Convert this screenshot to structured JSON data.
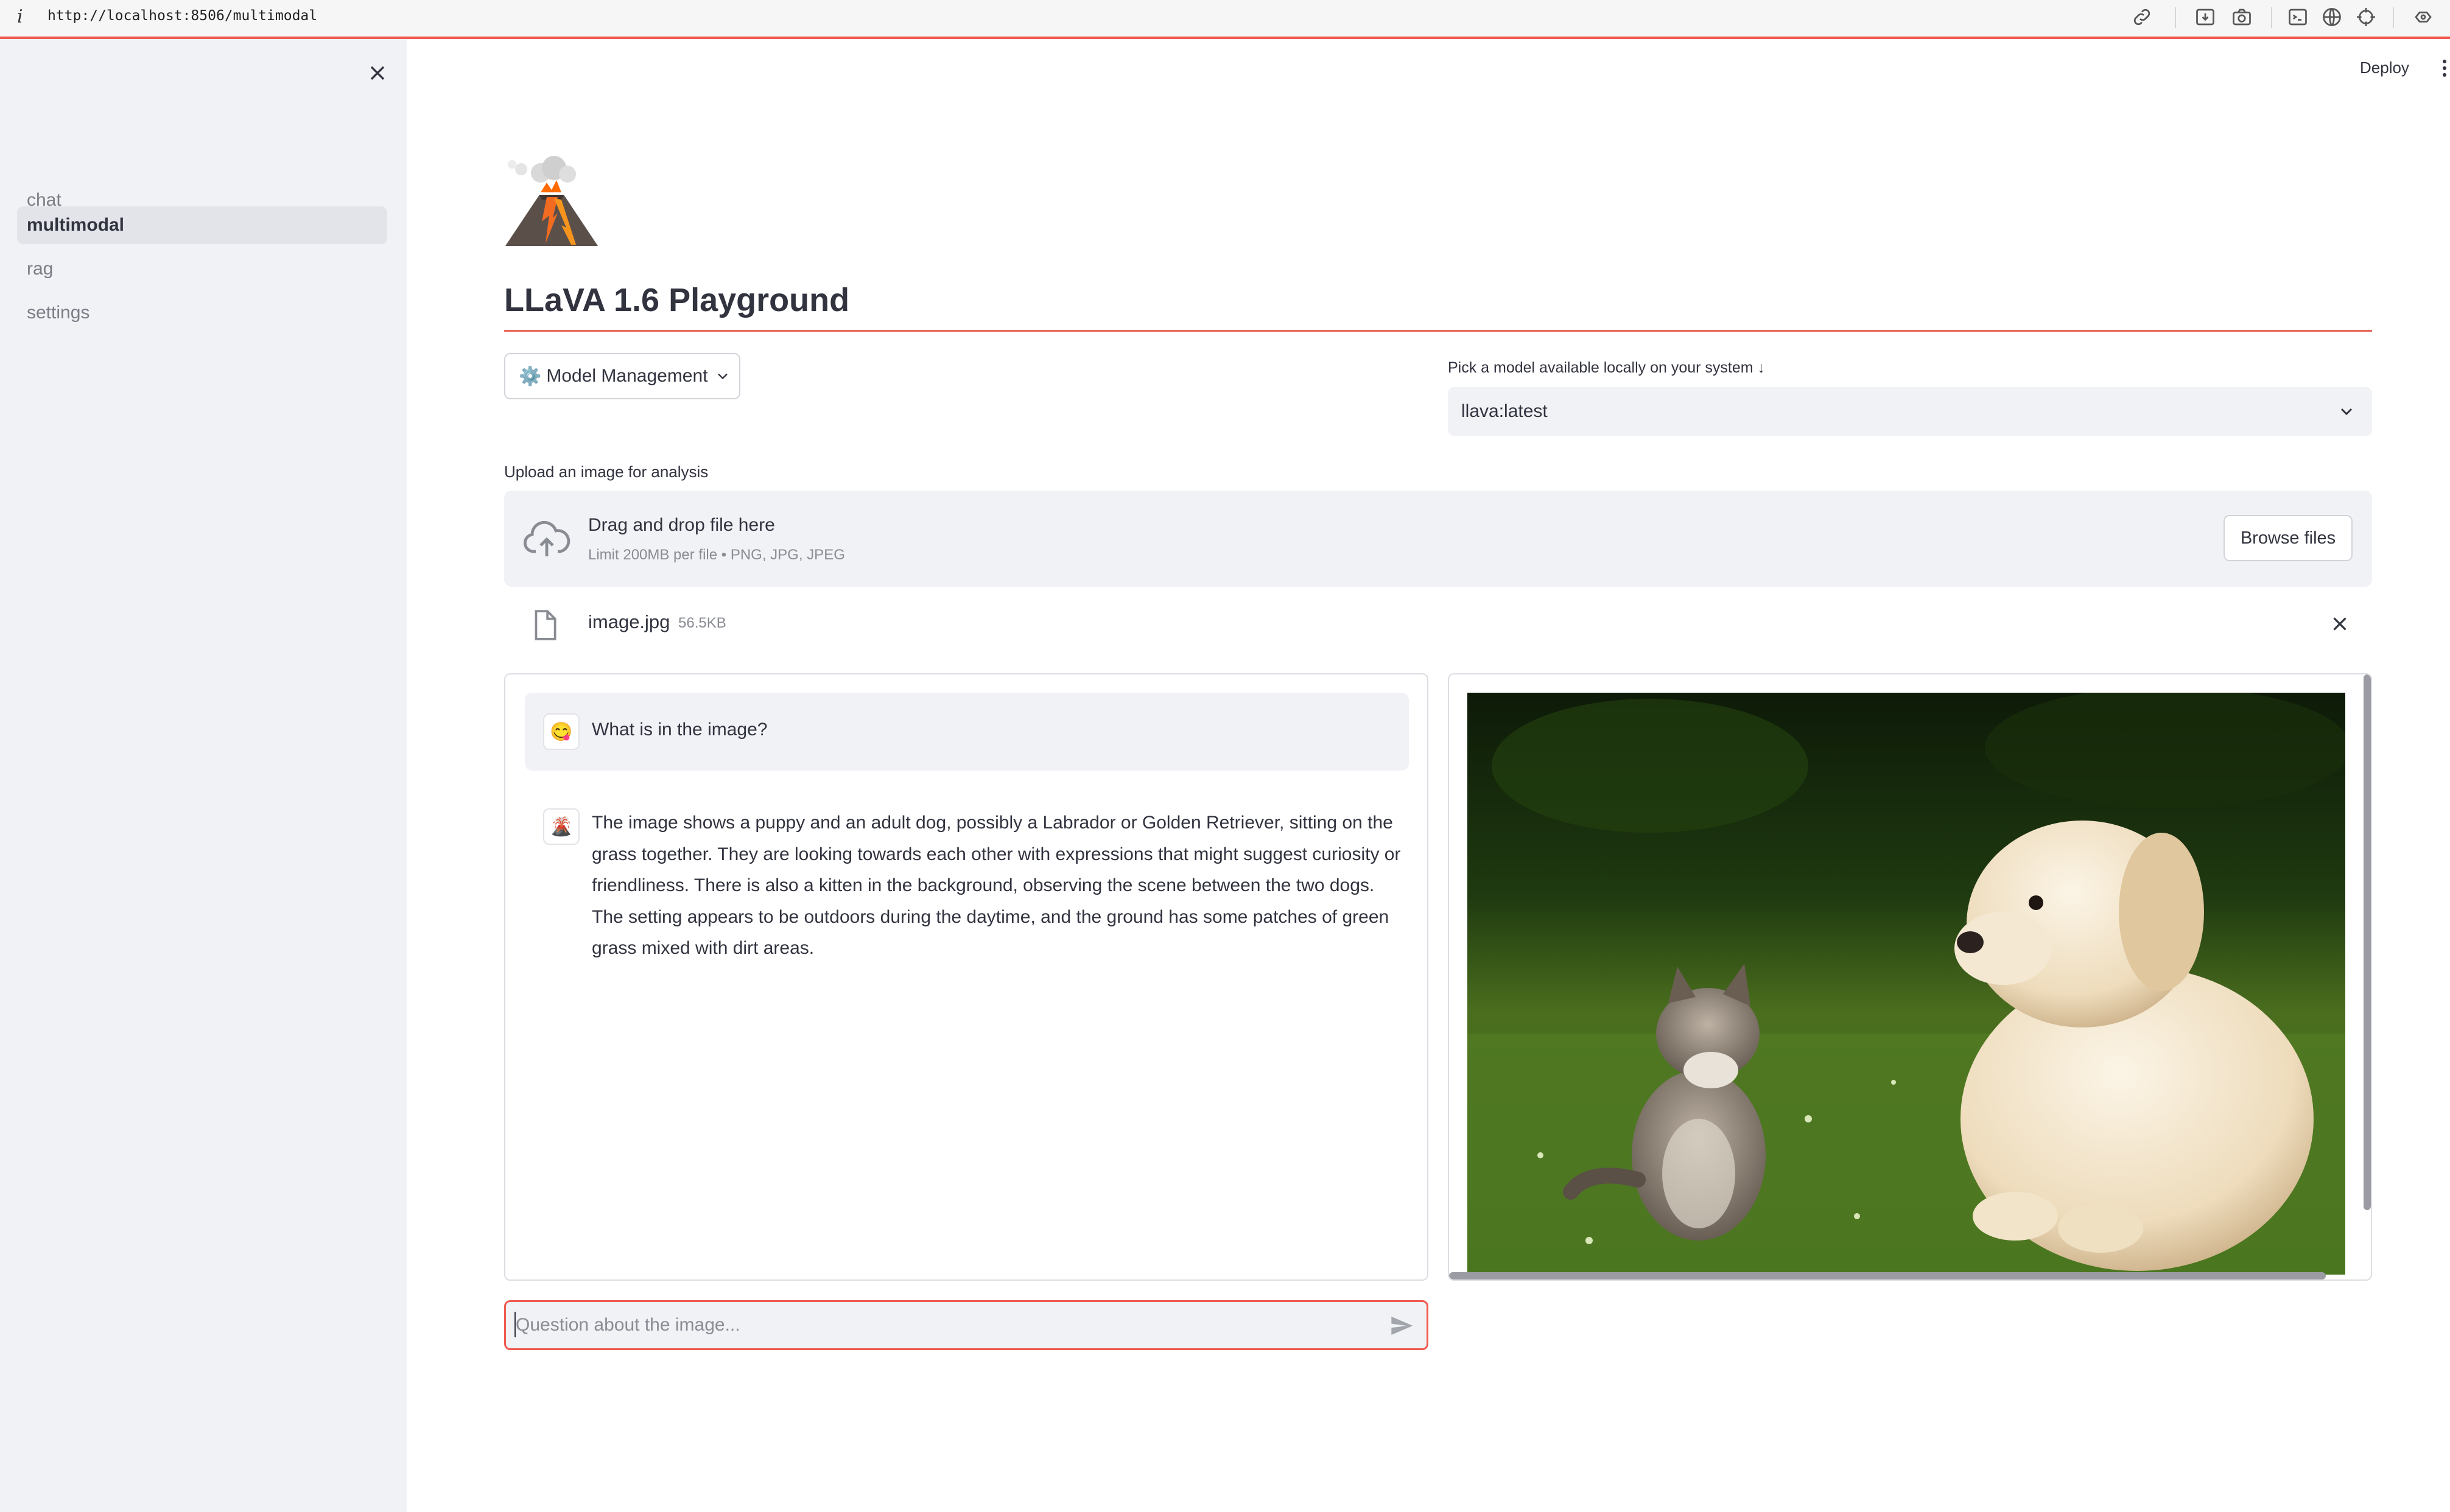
{
  "browser": {
    "url": "http://localhost:8506/multimodal",
    "info_icon_label": "i",
    "toolbar_icons": [
      "link-icon",
      "download-icon",
      "camera-icon",
      "terminal-icon",
      "globe-icon",
      "crosshair-icon",
      "extension-icon"
    ]
  },
  "sidebar": {
    "items": [
      {
        "label": "chat",
        "active": false
      },
      {
        "label": "multimodal",
        "active": true
      },
      {
        "label": "rag",
        "active": false
      },
      {
        "label": "settings",
        "active": false
      }
    ]
  },
  "header": {
    "deploy_label": "Deploy"
  },
  "page": {
    "title": "LLaVA 1.6 Playground",
    "icon": "volcano-emoji",
    "accent_color": "#f05a4f"
  },
  "model_management": {
    "label": "Model Management",
    "gear_glyph": "⚙️"
  },
  "model_picker": {
    "label": "Pick a model available locally on your system ↓",
    "selected": "llava:latest"
  },
  "uploader": {
    "label": "Upload an image for analysis",
    "drop_title": "Drag and drop file here",
    "limit_text": "Limit 200MB per file • PNG, JPG, JPEG",
    "browse_label": "Browse files"
  },
  "uploaded_file": {
    "name": "image.jpg",
    "size": "56.5KB"
  },
  "chat": {
    "messages": [
      {
        "role": "user",
        "avatar": "😋",
        "text": "What is in the image?"
      },
      {
        "role": "assistant",
        "avatar": "🌋",
        "text": "The image shows a puppy and an adult dog, possibly a Labrador or Golden Retriever, sitting on the grass together. They are looking towards each other with expressions that might suggest curiosity or friendliness. There is also a kitten in the background, observing the scene between the two dogs. The setting appears to be outdoors during the daytime, and the ground has some patches of green grass mixed with dirt areas."
      }
    ],
    "input_placeholder": "Question about the image..."
  },
  "image_preview": {
    "subject": "puppy-and-kitten-photo"
  }
}
